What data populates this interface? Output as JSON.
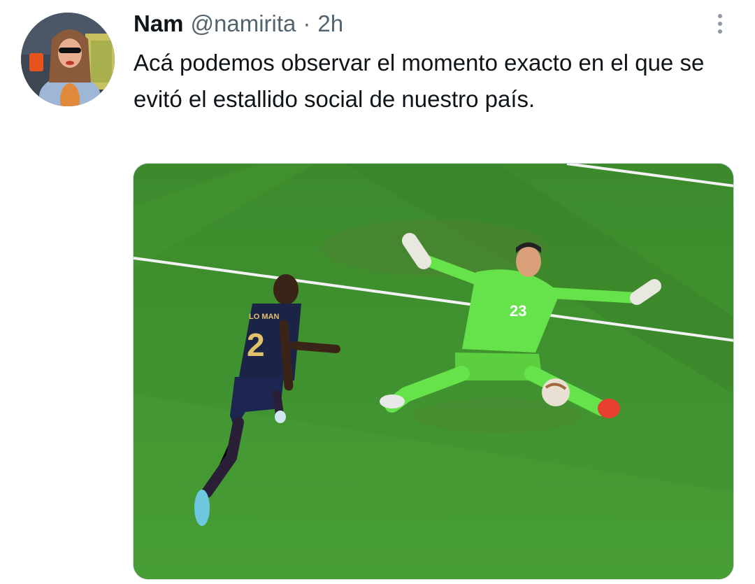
{
  "tweet": {
    "author_name": "Nam",
    "author_handle": "@namirita",
    "separator": "·",
    "timestamp": "2h",
    "text": "Acá podemos observar el momento exacto en el que se evitó el estallido social de nuestro país.",
    "media": {
      "description_icon": "photo",
      "jersey_numbers": [
        "2",
        "23"
      ],
      "jersey_name": "LO MAN"
    }
  },
  "colors": {
    "text": "#0f1419",
    "secondary": "#536471",
    "pitch": "#3f8a2e",
    "keeper_kit": "#66e24a",
    "france_kit": "#1b2347"
  },
  "icons": {
    "more": "more-vertical-icon",
    "avatar": "user-avatar"
  }
}
